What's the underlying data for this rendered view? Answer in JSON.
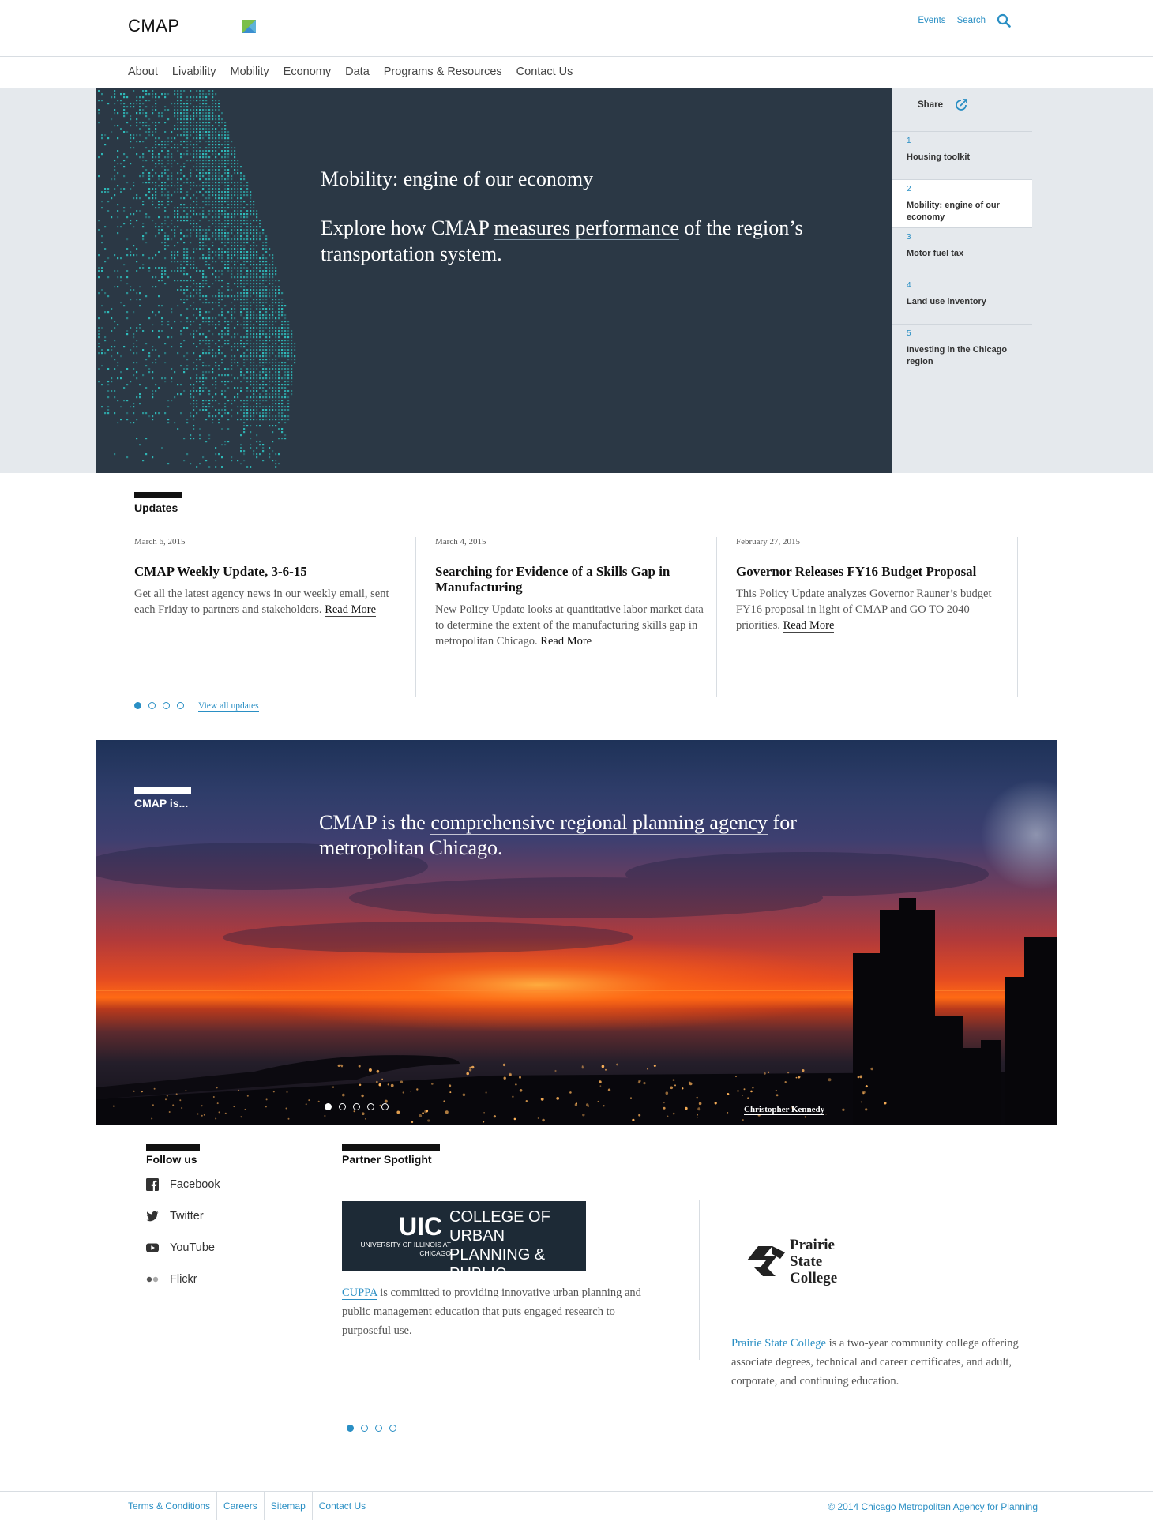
{
  "brand": {
    "name": "CMAP"
  },
  "util": {
    "events": "Events",
    "search": "Search"
  },
  "nav": [
    "About",
    "Livability",
    "Mobility",
    "Economy",
    "Data",
    "Programs & Resources",
    "Contact Us"
  ],
  "hero": {
    "title": "Mobility: engine of our economy",
    "text_before": "Explore how CMAP ",
    "text_link": "measures performance",
    "text_after": " of the region’s transportation system."
  },
  "side": {
    "share_label": "Share",
    "items": [
      {
        "num": "1",
        "label": "Housing toolkit"
      },
      {
        "num": "2",
        "label": "Mobility: engine of our economy",
        "active": true
      },
      {
        "num": "3",
        "label": "Motor fuel tax"
      },
      {
        "num": "4",
        "label": "Land use inventory"
      },
      {
        "num": "5",
        "label": "Investing in the Chicago region"
      }
    ]
  },
  "updates": {
    "heading": "Updates",
    "items": [
      {
        "date": "March 6, 2015",
        "title": "CMAP Weekly Update, 3-6-15",
        "body": "Get all the latest agency news in our weekly email, sent each Friday to partners and stakeholders.",
        "more": "Read More"
      },
      {
        "date": "March 4, 2015",
        "title": "Searching for Evidence of a Skills Gap in Manufacturing",
        "body": "New Policy Update looks at quantitative labor market data to determine the extent of the manufacturing skills gap in metropolitan Chicago.",
        "more": "Read More"
      },
      {
        "date": "February 27, 2015",
        "title": "Governor Releases FY16 Budget Proposal",
        "body": "This Policy Update analyzes Governor Rauner’s budget FY16 proposal in light of CMAP and GO TO 2040 priorities.",
        "more": "Read More"
      }
    ],
    "view_all": "View all updates"
  },
  "cmap_is": {
    "heading": "CMAP is...",
    "text_before": "CMAP is the ",
    "text_link": "comprehensive regional planning agency",
    "text_after": " for metropolitan Chicago.",
    "credit": "Christopher Kennedy"
  },
  "follow": {
    "heading": "Follow us",
    "items": [
      {
        "label": "Facebook",
        "icon": "facebook-icon"
      },
      {
        "label": "Twitter",
        "icon": "twitter-icon"
      },
      {
        "label": "YouTube",
        "icon": "youtube-icon"
      },
      {
        "label": "Flickr",
        "icon": "flickr-icon"
      }
    ]
  },
  "partner": {
    "heading": "Partner Spotlight",
    "uic": {
      "logo_big": "UIC",
      "logo_small": "UNIVERSITY OF ILLINOIS AT CHICAGO",
      "logo_college": "COLLEGE OF URBAN PLANNING & PUBLIC AFFAIRS",
      "link": "CUPPA",
      "text": " is committed to providing innovative urban planning and public management education that puts engaged research to purposeful use."
    },
    "psc": {
      "logo_text": [
        "Prairie",
        "State",
        "College"
      ],
      "link": "Prairie State College",
      "text": " is a two-year community college offering associate degrees, technical and career certificates, and adult, corporate, and continuing education."
    }
  },
  "footer": {
    "links": [
      "Terms & Conditions",
      "Careers",
      "Sitemap",
      "Contact Us"
    ],
    "copyright": "© 2014 Chicago Metropolitan Agency for Planning"
  },
  "colors": {
    "accent": "#2a8fc4",
    "hero_bg": "#2b3845",
    "map_dots": "#2fc1c0"
  }
}
